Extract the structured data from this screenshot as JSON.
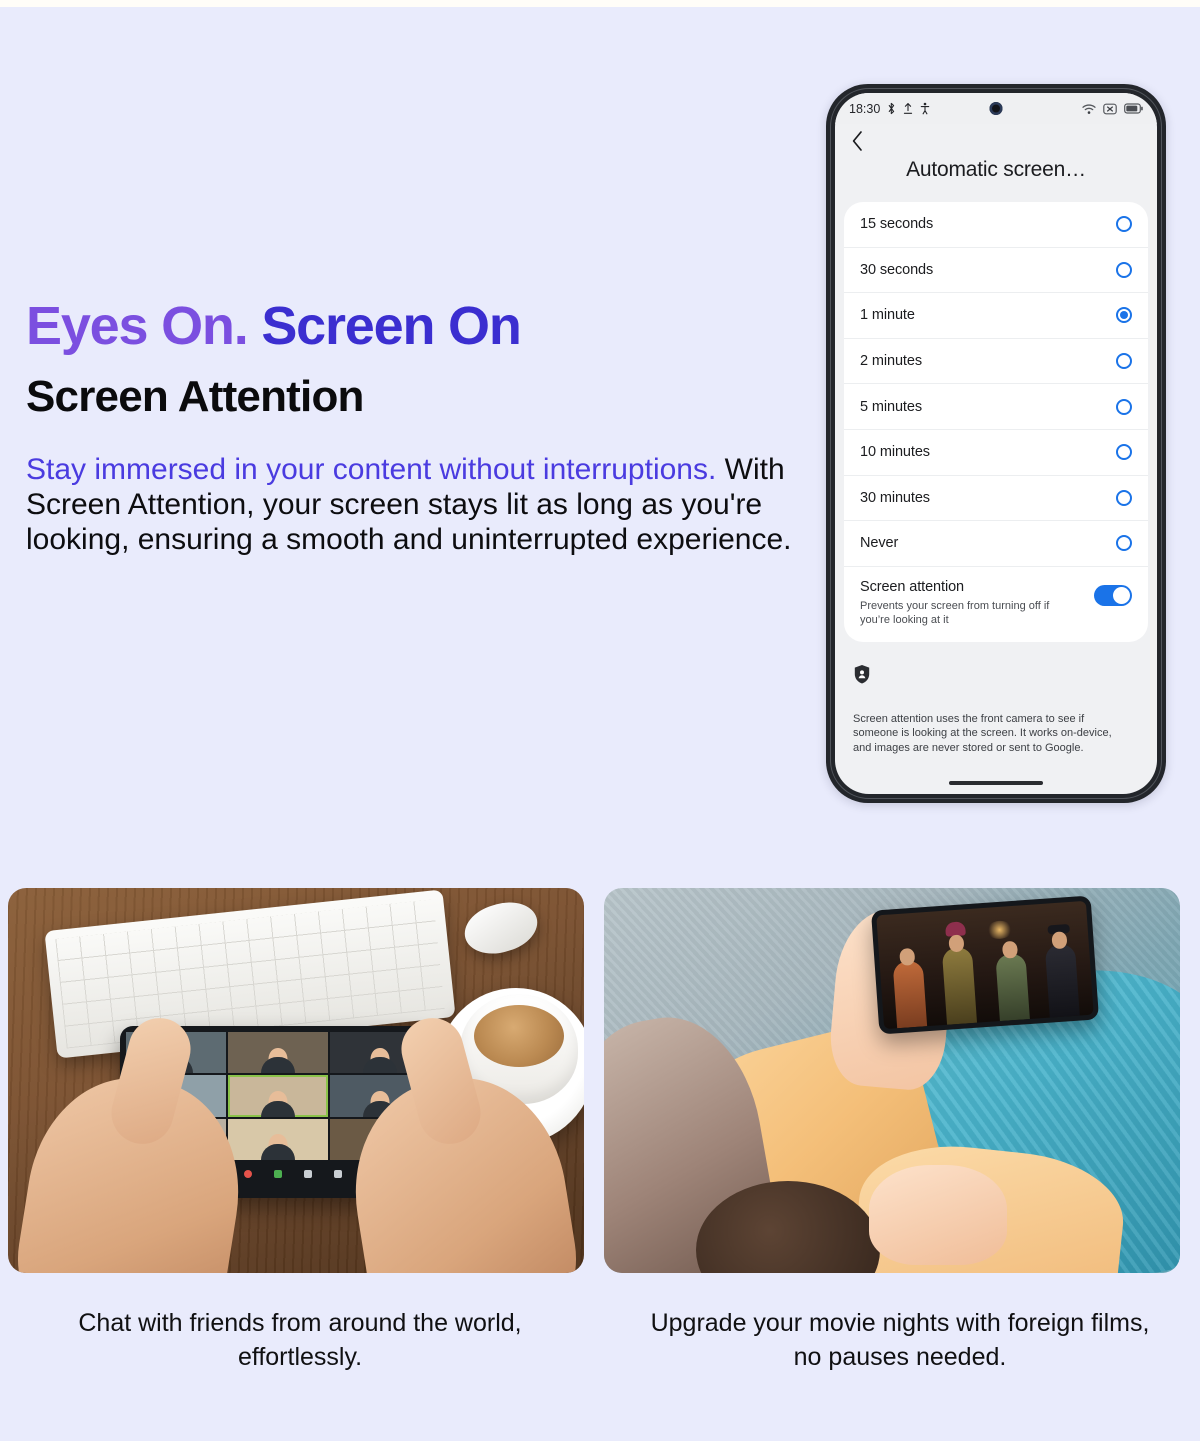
{
  "theme": {
    "background": "#e9ebfc",
    "headline_purple": "#7b4fe0",
    "headline_blue": "#3b2ed0",
    "accent_blue": "#1a73e8"
  },
  "copy": {
    "headline_part1": "Eyes On.",
    "headline_part2": "Screen On",
    "subheading": "Screen Attention",
    "body_lead": "Stay immersed in your content without interruptions.",
    "body_rest": " With Screen Attention, your screen stays lit as long as you're looking, ensuring a smooth and uninterrupted experience."
  },
  "phone": {
    "status_bar": {
      "time": "18:30",
      "left_icons": [
        "bluetooth-icon",
        "upload-icon",
        "accessibility-icon"
      ],
      "right_icons": [
        "wifi-icon",
        "no-sim-icon",
        "battery-icon"
      ]
    },
    "nav": {
      "back_label": "‹",
      "title": "Automatic screen…"
    },
    "timeout_options": [
      {
        "label": "15 seconds",
        "selected": false
      },
      {
        "label": "30 seconds",
        "selected": false
      },
      {
        "label": "1 minute",
        "selected": true
      },
      {
        "label": "2 minutes",
        "selected": false
      },
      {
        "label": "5 minutes",
        "selected": false
      },
      {
        "label": "10 minutes",
        "selected": false
      },
      {
        "label": "30 minutes",
        "selected": false
      },
      {
        "label": "Never",
        "selected": false
      }
    ],
    "toggle": {
      "title": "Screen attention",
      "description": "Prevents your screen from turning off if you’re looking at it",
      "state": "on"
    },
    "info": {
      "icon": "privacy-shield-icon",
      "note": "Screen attention uses the front camera to see if someone is looking at the screen. It works on-device, and images are never stored or sent to Google."
    }
  },
  "photos": [
    {
      "name": "video-call-photo",
      "caption_line1": "Chat with friends from around the world,",
      "caption_line2": "effortlessly."
    },
    {
      "name": "movie-watching-photo",
      "caption_line1": "Upgrade your movie nights with foreign films,",
      "caption_line2": "no pauses needed."
    }
  ]
}
